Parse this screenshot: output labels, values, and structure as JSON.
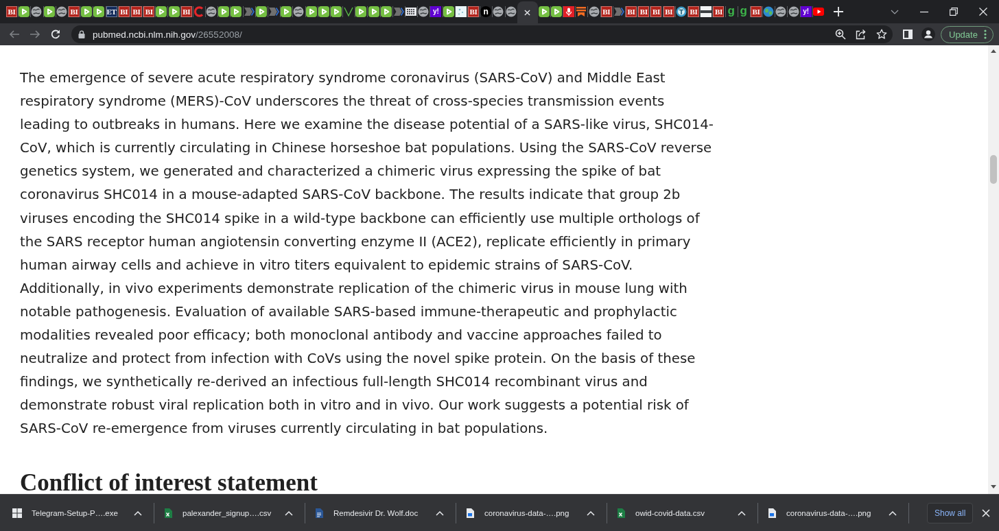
{
  "tabs": [
    {
      "kind": "tile",
      "text": "BI",
      "color": "#b3241c",
      "selected": false
    },
    {
      "kind": "play",
      "selected": false
    },
    {
      "kind": "globe",
      "selected": false
    },
    {
      "kind": "play",
      "selected": false
    },
    {
      "kind": "globe",
      "selected": false
    },
    {
      "kind": "tile",
      "text": "BI",
      "color": "#b3241c",
      "selected": false
    },
    {
      "kind": "play",
      "selected": false
    },
    {
      "kind": "play",
      "selected": false
    },
    {
      "kind": "tile",
      "text": "ET",
      "color": "#142c5c",
      "selected": false
    },
    {
      "kind": "tile",
      "text": "BI",
      "color": "#b3241c",
      "selected": false
    },
    {
      "kind": "tile",
      "text": "BI",
      "color": "#b3241c",
      "selected": false
    },
    {
      "kind": "tile",
      "text": "BI",
      "color": "#b3241c",
      "selected": false
    },
    {
      "kind": "play",
      "selected": false
    },
    {
      "kind": "play",
      "selected": false
    },
    {
      "kind": "tile",
      "text": "BI",
      "color": "#b3241c",
      "selected": false
    },
    {
      "kind": "arc",
      "selected": false
    },
    {
      "kind": "globe",
      "selected": false
    },
    {
      "kind": "play",
      "selected": false
    },
    {
      "kind": "play",
      "selected": false
    },
    {
      "kind": "tag",
      "selected": false
    },
    {
      "kind": "play",
      "selected": false
    },
    {
      "kind": "tag",
      "selected": false
    },
    {
      "kind": "play",
      "selected": false
    },
    {
      "kind": "globe",
      "selected": false
    },
    {
      "kind": "play",
      "selected": false
    },
    {
      "kind": "play",
      "selected": false
    },
    {
      "kind": "play",
      "selected": false
    },
    {
      "kind": "vee",
      "selected": false
    },
    {
      "kind": "play",
      "selected": false
    },
    {
      "kind": "play",
      "selected": false
    },
    {
      "kind": "play",
      "selected": false
    },
    {
      "kind": "tag",
      "selected": false
    },
    {
      "kind": "news",
      "selected": false
    },
    {
      "kind": "globe",
      "selected": false
    },
    {
      "kind": "square",
      "text": "y!",
      "color": "#6001d2",
      "selected": false
    },
    {
      "kind": "play",
      "selected": false
    },
    {
      "kind": "image",
      "selected": false
    },
    {
      "kind": "tile",
      "text": "BI",
      "color": "#b3241c",
      "selected": false
    },
    {
      "kind": "disc",
      "text": "n",
      "color": "#000000",
      "selected": false
    },
    {
      "kind": "globe",
      "selected": false
    },
    {
      "kind": "globe",
      "selected": false
    },
    {
      "selected": true
    },
    {
      "kind": "play",
      "selected": false
    },
    {
      "kind": "play",
      "selected": false
    },
    {
      "kind": "mic",
      "selected": false
    },
    {
      "kind": "bookmark",
      "selected": false
    },
    {
      "kind": "globe",
      "selected": false
    },
    {
      "kind": "tile",
      "text": "BI",
      "color": "#b3241c",
      "selected": false
    },
    {
      "kind": "tag",
      "selected": false
    },
    {
      "kind": "tile",
      "text": "BI",
      "color": "#b3241c",
      "selected": false
    },
    {
      "kind": "tile",
      "text": "BI",
      "color": "#b3241c",
      "selected": false
    },
    {
      "kind": "tile",
      "text": "BI",
      "color": "#b3241c",
      "selected": false
    },
    {
      "kind": "tile",
      "text": "BI",
      "color": "#b3241c",
      "selected": false
    },
    {
      "kind": "emblem",
      "selected": false
    },
    {
      "kind": "tile",
      "text": "BI",
      "color": "#b3241c",
      "selected": false
    },
    {
      "kind": "bars",
      "selected": false
    },
    {
      "kind": "tile",
      "text": "BI",
      "color": "#b3241c",
      "selected": false
    },
    {
      "kind": "letter",
      "text": "g",
      "color": "#3db54a",
      "selected": false
    },
    {
      "kind": "letter",
      "text": "g",
      "color": "#3db54a",
      "selected": false
    },
    {
      "kind": "tile",
      "text": "BI",
      "color": "#b3241c",
      "selected": false
    },
    {
      "kind": "earth",
      "selected": false
    },
    {
      "kind": "globe",
      "selected": false
    },
    {
      "kind": "globe",
      "selected": false
    },
    {
      "kind": "square",
      "text": "y!",
      "color": "#6001d2",
      "selected": false
    },
    {
      "kind": "video",
      "selected": false
    }
  ],
  "toolbar": {
    "back": {
      "disabled": true
    },
    "forward": {
      "disabled": true
    },
    "url": {
      "host": "pubmed.ncbi.nlm.nih.gov",
      "path": "/26552008/"
    },
    "update_button": "Update"
  },
  "article": {
    "abstract": "The emergence of severe acute respiratory syndrome coronavirus (SARS-CoV) and Middle East respiratory syndrome (MERS)-CoV underscores the threat of cross-species transmission events leading to outbreaks in humans. Here we examine the disease potential of a SARS-like virus, SHC014-CoV, which is currently circulating in Chinese horseshoe bat populations. Using the SARS-CoV reverse genetics system, we generated and characterized a chimeric virus expressing the spike of bat coronavirus SHC014 in a mouse-adapted SARS-CoV backbone. The results indicate that group 2b viruses encoding the SHC014 spike in a wild-type backbone can efficiently use multiple orthologs of the SARS receptor human angiotensin converting enzyme II (ACE2), replicate efficiently in primary human airway cells and achieve in vitro titers equivalent to epidemic strains of SARS-CoV. Additionally, in vivo experiments demonstrate replication of the chimeric virus in mouse lung with notable pathogenesis. Evaluation of available SARS-based immune-therapeutic and prophylactic modalities revealed poor efficacy; both monoclonal antibody and vaccine approaches failed to neutralize and protect from infection with CoVs using the novel spike protein. On the basis of these findings, we synthetically re-derived an infectious full-length SHC014 recombinant virus and demonstrate robust viral replication both in vitro and in vivo. Our work suggests a potential risk of SARS-CoV re-emergence from viruses currently circulating in bat populations.",
    "next_heading": "Conflict of interest statement"
  },
  "downloads": {
    "items": [
      {
        "kind": "app",
        "name": "Telegram-Setup-P….exe"
      },
      {
        "kind": "sheet",
        "name": "palexander_signup….csv"
      },
      {
        "kind": "doc",
        "name": "Remdesivir Dr. Wolf.doc"
      },
      {
        "kind": "image",
        "name": "coronavirus-data-….png"
      },
      {
        "kind": "sheet",
        "name": "owid-covid-data.csv"
      },
      {
        "kind": "image",
        "name": "coronavirus-data-….png"
      }
    ],
    "show_all": "Show all"
  }
}
